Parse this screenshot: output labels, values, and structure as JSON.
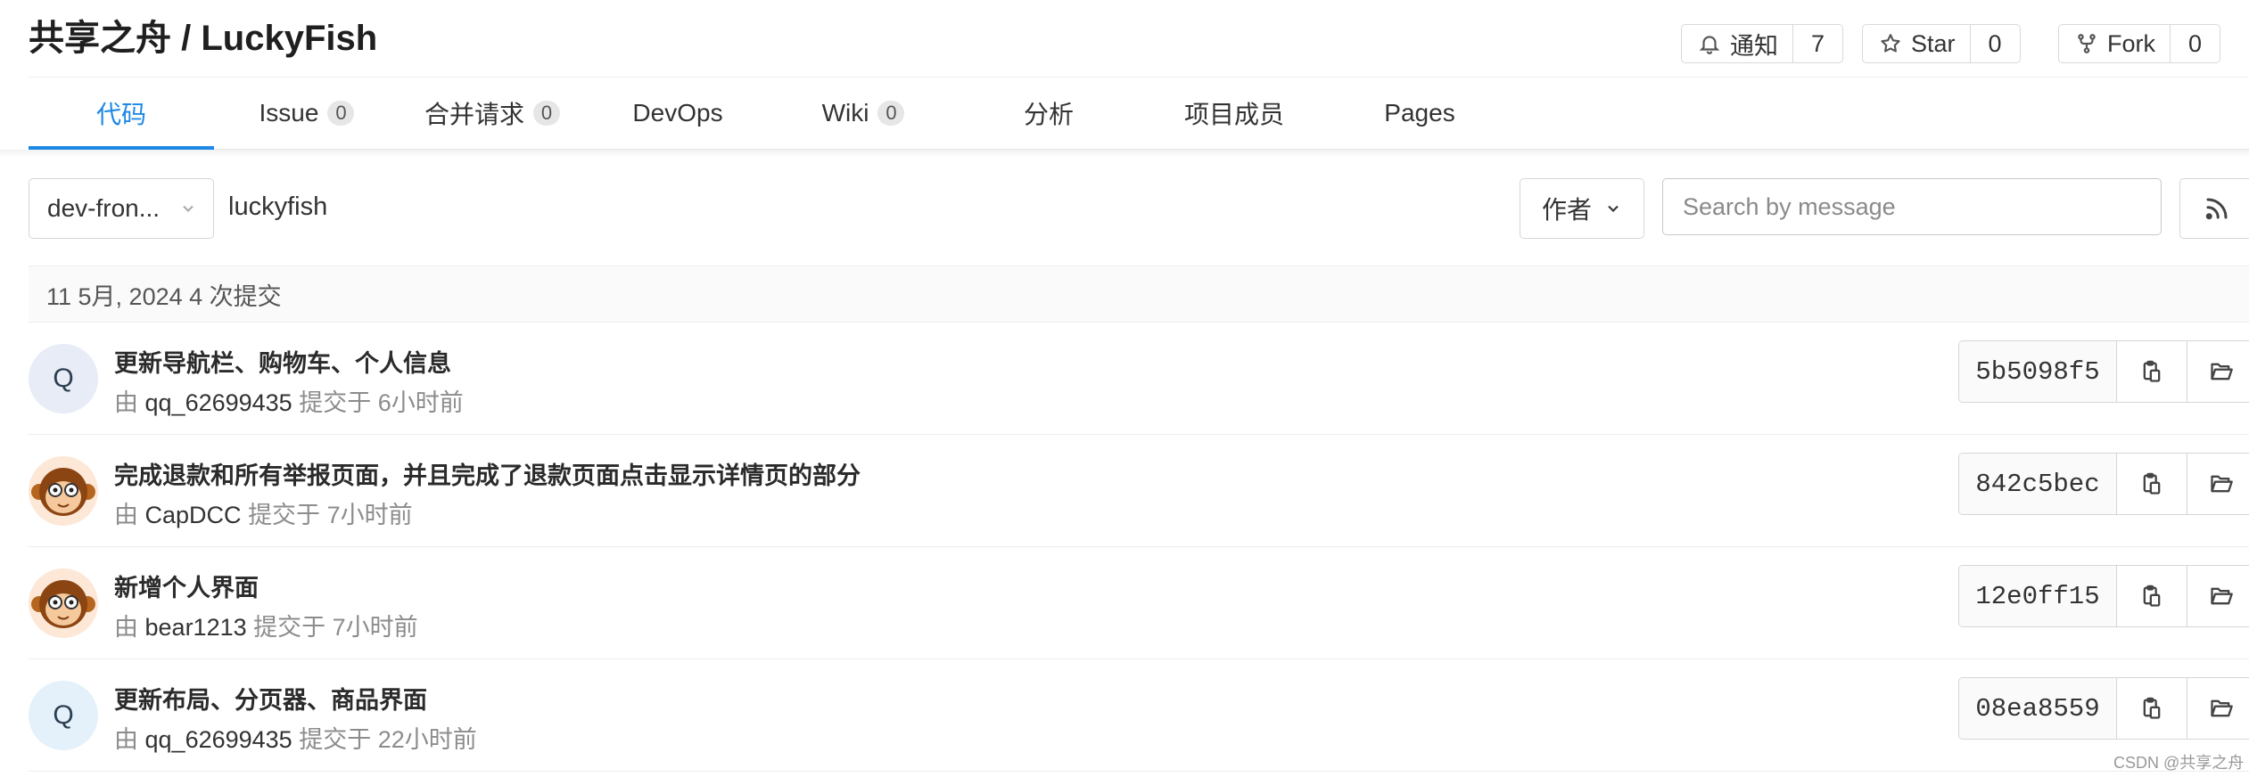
{
  "header": {
    "title": "共享之舟 / LuckyFish",
    "notify": {
      "label": "通知",
      "count": "7",
      "icon": "bell-icon"
    },
    "star": {
      "label": "Star",
      "count": "0",
      "icon": "star-icon"
    },
    "fork": {
      "label": "Fork",
      "count": "0",
      "icon": "fork-icon"
    }
  },
  "tabs": [
    {
      "label": "代码",
      "badge": null,
      "active": true
    },
    {
      "label": "Issue",
      "badge": "0"
    },
    {
      "label": "合并请求",
      "badge": "0"
    },
    {
      "label": "DevOps",
      "badge": null
    },
    {
      "label": "Wiki",
      "badge": "0"
    },
    {
      "label": "分析",
      "badge": null
    },
    {
      "label": "项目成员",
      "badge": null
    },
    {
      "label": "Pages",
      "badge": null
    }
  ],
  "filters": {
    "branch": "dev-fron...",
    "path": "luckyfish",
    "author_label": "作者",
    "search_placeholder": "Search by message",
    "rss_icon": "rss-icon"
  },
  "date_group": "11 5月, 2024 4 次提交",
  "commits": [
    {
      "title": "更新导航栏、购物车、个人信息",
      "by": "由",
      "author": "qq_62699435",
      "action": "提交于",
      "time": "6小时前",
      "sha": "5b5098f5",
      "avatar": "Q"
    },
    {
      "title": "完成退款和所有举报页面，并且完成了退款页面点击显示详情页的部分",
      "by": "由",
      "author": "CapDCC",
      "action": "提交于",
      "time": "7小时前",
      "sha": "842c5bec",
      "avatar": "monkey-avatar"
    },
    {
      "title": "新增个人界面",
      "by": "由",
      "author": "bear1213",
      "action": "提交于",
      "time": "7小时前",
      "sha": "12e0ff15",
      "avatar": "monkey-avatar"
    },
    {
      "title": "更新布局、分页器、商品界面",
      "by": "由",
      "author": "qq_62699435",
      "action": "提交于",
      "time": "22小时前",
      "sha": "08ea8559",
      "avatar": "Q"
    }
  ],
  "colors": {
    "accent": "#1e88e5"
  },
  "watermark": "CSDN @共享之舟"
}
